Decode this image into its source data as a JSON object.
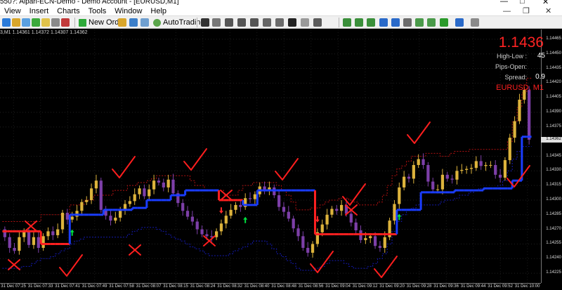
{
  "window": {
    "title": "550?: Alpari-ECN-Demo - Demo Account - [EURUSD,M1]",
    "controls": {
      "minimize": "—",
      "maximize": "□",
      "close": "✕"
    }
  },
  "menu": {
    "items": [
      "View",
      "Insert",
      "Charts",
      "Tools",
      "Window",
      "Help"
    ],
    "controls": {
      "minimize": "—",
      "restore": "❐",
      "close": "✕"
    }
  },
  "toolbar": {
    "new_order_label": "New Order",
    "autotrading_label": "AutoTrading"
  },
  "chart": {
    "ohlc_text": "3,M1  1.14361 1.14372 1.14307 1.14362",
    "price_panel": {
      "price": "1.1436",
      "high_low_label": "High-Low :",
      "high_low_value": "45",
      "pips_open_label": "Pips-Open:",
      "pips_open_value": "",
      "spread_label": "Spread:",
      "spread_value": "0.9",
      "symbol": "EURUSD, M1"
    },
    "current_price_tag": "1.14362",
    "y_ticks": [
      "1.14465",
      "1.14450",
      "1.14435",
      "1.14420",
      "1.14405",
      "1.14390",
      "1.14375",
      "1.14345",
      "1.14330",
      "1.14315",
      "1.14300",
      "1.14285",
      "1.14270",
      "1.14255",
      "1.14240",
      "1.14225"
    ],
    "x_ticks": [
      "31 Dec 07:25",
      "31 Dec 07:33",
      "31 Dec 07:41",
      "31 Dec 07:49",
      "31 Dec 07:58",
      "31 Dec 08:07",
      "31 Dec 08:15",
      "31 Dec 08:24",
      "31 Dec 08:32",
      "31 Dec 08:40",
      "31 Dec 08:48",
      "31 Dec 08:56",
      "31 Dec 09:04",
      "31 Dec 09:12",
      "31 Dec 09:20",
      "31 Dec 09:28",
      "31 Dec 09:36",
      "31 Dec 09:44",
      "31 Dec 09:52",
      "31 Dec 10:00"
    ],
    "colors": {
      "bull": "#ddb33c",
      "bear": "#7d3fa8",
      "trend_up": "#1a3dff",
      "trend_down": "#ff2020",
      "channel_upper": "#b01010",
      "channel_lower": "#141ab0",
      "up_arrow": "#00e040",
      "down_arrow": "#ff2a2a",
      "marks": "#ff1e1e"
    },
    "chart_data": {
      "type": "candlestick",
      "symbol": "EURUSD",
      "timeframe": "M1",
      "y_range": [
        1.14215,
        1.14475
      ],
      "last_price": 1.14362,
      "open": [
        1.1427,
        1.14262,
        1.14251,
        1.14248,
        1.14262,
        1.14268,
        1.14254,
        1.14262,
        1.14251,
        1.14263,
        1.14268,
        1.14264,
        1.1427,
        1.14287,
        1.1428,
        1.14283,
        1.14289,
        1.14298,
        1.143,
        1.14312,
        1.1432,
        1.1429,
        1.14284,
        1.14279,
        1.14282,
        1.1429,
        1.14296,
        1.14299,
        1.14306,
        1.14312,
        1.14304,
        1.14311,
        1.1432,
        1.14318,
        1.14313,
        1.14321,
        1.14307,
        1.14297,
        1.14289,
        1.14283,
        1.14278,
        1.1427,
        1.14265,
        1.14263,
        1.14262,
        1.14268,
        1.14276,
        1.14284,
        1.1429,
        1.14295,
        1.14293,
        1.14302,
        1.14301,
        1.14306,
        1.14314,
        1.1431,
        1.14313,
        1.14305,
        1.14293,
        1.14288,
        1.14281,
        1.14271,
        1.14263,
        1.14251,
        1.14246,
        1.14255,
        1.14267,
        1.14275,
        1.14285,
        1.14291,
        1.14289,
        1.14295,
        1.14286,
        1.14277,
        1.14269,
        1.14259,
        1.14261,
        1.14263,
        1.14253,
        1.14251,
        1.14262,
        1.14279,
        1.14296,
        1.14313,
        1.14324,
        1.14322,
        1.14336,
        1.14342,
        1.14336,
        1.14319,
        1.14311,
        1.14311,
        1.14326,
        1.14322,
        1.14321,
        1.1433,
        1.14331,
        1.14332,
        1.14333,
        1.1434,
        1.14335,
        1.14336,
        1.14336,
        1.14326,
        1.14323,
        1.14341,
        1.14364,
        1.14381,
        1.14403,
        1.14413
      ],
      "close": [
        1.14262,
        1.14251,
        1.14248,
        1.14262,
        1.14268,
        1.14254,
        1.14262,
        1.14251,
        1.14263,
        1.14268,
        1.14264,
        1.1427,
        1.14287,
        1.1428,
        1.14283,
        1.14289,
        1.14298,
        1.143,
        1.14312,
        1.1432,
        1.1429,
        1.14284,
        1.14279,
        1.14282,
        1.1429,
        1.14296,
        1.14299,
        1.14306,
        1.14312,
        1.14304,
        1.14311,
        1.1432,
        1.14318,
        1.14313,
        1.14321,
        1.14307,
        1.14297,
        1.14289,
        1.14283,
        1.14278,
        1.1427,
        1.14265,
        1.14263,
        1.14262,
        1.14268,
        1.14276,
        1.14284,
        1.1429,
        1.14295,
        1.14293,
        1.14302,
        1.14301,
        1.14306,
        1.14314,
        1.1431,
        1.14313,
        1.14305,
        1.14293,
        1.14288,
        1.14281,
        1.14271,
        1.14263,
        1.14251,
        1.14246,
        1.14255,
        1.14267,
        1.14275,
        1.14285,
        1.14291,
        1.14289,
        1.14295,
        1.14286,
        1.14277,
        1.14269,
        1.14259,
        1.14261,
        1.14263,
        1.14253,
        1.14251,
        1.14262,
        1.14279,
        1.14296,
        1.14313,
        1.14324,
        1.14322,
        1.14336,
        1.14342,
        1.14336,
        1.14319,
        1.14311,
        1.14311,
        1.14326,
        1.14322,
        1.14321,
        1.1433,
        1.14331,
        1.14332,
        1.14333,
        1.1434,
        1.14335,
        1.14336,
        1.14336,
        1.14326,
        1.14323,
        1.14341,
        1.14364,
        1.14381,
        1.14403,
        1.14413,
        1.14362
      ],
      "trend_line": [
        1.14268,
        1.14268,
        1.14268,
        1.14268,
        1.14268,
        1.14268,
        1.14268,
        1.14268,
        1.14255,
        1.14255,
        1.14255,
        1.14255,
        1.14255,
        1.14255,
        1.14285,
        1.14285,
        1.14285,
        1.14285,
        1.14285,
        1.14285,
        1.14285,
        1.1429,
        1.1429,
        1.1429,
        1.1429,
        1.1429,
        1.1429,
        1.14292,
        1.14292,
        1.14292,
        1.143,
        1.143,
        1.143,
        1.143,
        1.143,
        1.14305,
        1.14305,
        1.14305,
        1.1431,
        1.1431,
        1.1431,
        1.1431,
        1.1431,
        1.1431,
        1.1431,
        1.143,
        1.143,
        1.143,
        1.143,
        1.143,
        1.14295,
        1.14295,
        1.14295,
        1.1431,
        1.1431,
        1.1431,
        1.1431,
        1.1431,
        1.1431,
        1.1431,
        1.1431,
        1.1431,
        1.1431,
        1.1431,
        1.1431,
        1.14265,
        1.14265,
        1.14265,
        1.14265,
        1.14265,
        1.14265,
        1.14265,
        1.14265,
        1.14265,
        1.14265,
        1.14265,
        1.14265,
        1.14265,
        1.14265,
        1.14265,
        1.14265,
        1.14265,
        1.1429,
        1.1429,
        1.1429,
        1.1429,
        1.1429,
        1.14308,
        1.14308,
        1.14308,
        1.14308,
        1.14308,
        1.14308,
        1.14308,
        1.1431,
        1.1431,
        1.1431,
        1.1431,
        1.1431,
        1.1431,
        1.14312,
        1.14312,
        1.14312,
        1.14312,
        1.14312,
        1.14312,
        1.1432,
        1.1432,
        1.14365,
        1.14365,
        1.14368
      ],
      "trend_direction": [
        "down",
        "down",
        "down",
        "down",
        "down",
        "down",
        "down",
        "down",
        "down",
        "down",
        "down",
        "down",
        "down",
        "down",
        "up",
        "up",
        "up",
        "up",
        "up",
        "up",
        "up",
        "up",
        "up",
        "up",
        "up",
        "up",
        "up",
        "up",
        "up",
        "up",
        "up",
        "up",
        "up",
        "up",
        "up",
        "up",
        "up",
        "up",
        "up",
        "up",
        "up",
        "up",
        "up",
        "up",
        "up",
        "down",
        "down",
        "down",
        "down",
        "down",
        "up",
        "up",
        "up",
        "up",
        "up",
        "up",
        "up",
        "up",
        "up",
        "up",
        "up",
        "up",
        "up",
        "up",
        "up",
        "down",
        "down",
        "down",
        "down",
        "down",
        "down",
        "down",
        "down",
        "down",
        "down",
        "down",
        "down",
        "down",
        "down",
        "down",
        "down",
        "down",
        "up",
        "up",
        "up",
        "up",
        "up",
        "up",
        "up",
        "up",
        "up",
        "up",
        "up",
        "up",
        "up",
        "up",
        "up",
        "up",
        "up",
        "up",
        "up",
        "up",
        "up",
        "up",
        "up",
        "up",
        "up",
        "up",
        "up",
        "up",
        "up"
      ],
      "upper_channel": [
        1.14278,
        1.14278,
        1.14278,
        1.14278,
        1.14278,
        1.14278,
        1.14278,
        1.14278,
        1.14285,
        1.14285,
        1.14285,
        1.14285,
        1.14285,
        1.14285,
        1.14295,
        1.14295,
        1.14295,
        1.143,
        1.143,
        1.14305,
        1.14305,
        1.14305,
        1.14305,
        1.1431,
        1.1431,
        1.1431,
        1.14315,
        1.14315,
        1.14318,
        1.14318,
        1.1432,
        1.14322,
        1.14325,
        1.14325,
        1.14325,
        1.14325,
        1.14325,
        1.14325,
        1.14325,
        1.1432,
        1.14315,
        1.14315,
        1.1431,
        1.1431,
        1.1431,
        1.1431,
        1.14305,
        1.14305,
        1.14305,
        1.1431,
        1.14315,
        1.14315,
        1.14318,
        1.14318,
        1.14318,
        1.14318,
        1.14318,
        1.14315,
        1.1431,
        1.14305,
        1.14298,
        1.1429,
        1.1429,
        1.1429,
        1.14292,
        1.14292,
        1.14295,
        1.14298,
        1.143,
        1.143,
        1.14302,
        1.14302,
        1.143,
        1.14298,
        1.14295,
        1.14295,
        1.14295,
        1.14295,
        1.14298,
        1.14305,
        1.14315,
        1.14325,
        1.14332,
        1.14335,
        1.1434,
        1.14345,
        1.14345,
        1.14345,
        1.14348,
        1.14348,
        1.14348,
        1.14345,
        1.14345,
        1.14348,
        1.1435,
        1.1435,
        1.1435,
        1.14352,
        1.14352,
        1.14352,
        1.14352,
        1.14352,
        1.14352,
        1.14352,
        1.14352,
        1.1436,
        1.1438,
        1.14395,
        1.1441,
        1.14425
      ],
      "lower_channel": [
        1.1423,
        1.1423,
        1.1423,
        1.1423,
        1.14232,
        1.14232,
        1.14235,
        1.14238,
        1.1424,
        1.1424,
        1.14242,
        1.14245,
        1.14248,
        1.1425,
        1.14255,
        1.14258,
        1.1426,
        1.14262,
        1.14262,
        1.14262,
        1.14262,
        1.14262,
        1.14262,
        1.14262,
        1.14262,
        1.14262,
        1.14265,
        1.14268,
        1.1427,
        1.14272,
        1.14272,
        1.14272,
        1.1427,
        1.14268,
        1.14265,
        1.14262,
        1.1426,
        1.14258,
        1.14255,
        1.14252,
        1.1425,
        1.14248,
        1.14245,
        1.14243,
        1.14243,
        1.14243,
        1.14243,
        1.14245,
        1.14248,
        1.1425,
        1.14252,
        1.14255,
        1.14258,
        1.14258,
        1.14258,
        1.14255,
        1.1425,
        1.14245,
        1.14242,
        1.14238,
        1.14235,
        1.1423,
        1.14228,
        1.14228,
        1.14228,
        1.1423,
        1.14232,
        1.14235,
        1.14238,
        1.14238,
        1.14238,
        1.14235,
        1.14232,
        1.1423,
        1.1423,
        1.1423,
        1.14232,
        1.14235,
        1.1424,
        1.14245,
        1.14255,
        1.14268,
        1.14278,
        1.14285,
        1.1429,
        1.14292,
        1.14295,
        1.14295,
        1.14295,
        1.14295,
        1.14295,
        1.14298,
        1.143,
        1.143,
        1.14302,
        1.14305,
        1.14305,
        1.14308,
        1.1431,
        1.14312,
        1.14312,
        1.14312,
        1.14312,
        1.14315,
        1.1432,
        1.1433,
        1.14342,
        1.1435,
        1.14355,
        1.14355
      ]
    }
  }
}
